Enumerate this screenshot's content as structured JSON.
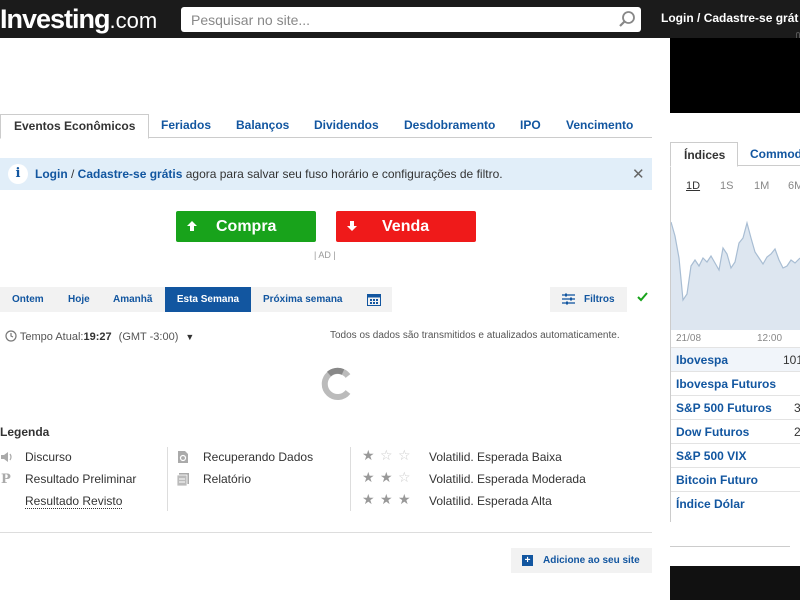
{
  "header": {
    "logo_main": "Investing",
    "logo_suffix": ".com",
    "search_placeholder": "Pesquisar no site...",
    "login": "Login",
    "separator": "/",
    "signup": "Cadastre-se grát"
  },
  "tabs": [
    {
      "label": "Eventos Econômicos",
      "active": true
    },
    {
      "label": "Feriados"
    },
    {
      "label": "Balanços"
    },
    {
      "label": "Dividendos"
    },
    {
      "label": "Desdobramento"
    },
    {
      "label": "IPO"
    },
    {
      "label": "Vencimento"
    }
  ],
  "banner": {
    "icon": "info-icon",
    "login": "Login",
    "separator": " / ",
    "signup": "Cadastre-se grátis",
    "text": " agora para salvar seu fuso horário e configurações de filtro."
  },
  "trade": {
    "buy_label": "Compra",
    "sell_label": "Venda",
    "ad_tag": "| AD |",
    "buy_color": "#18a31b",
    "sell_color": "#ef1a1a"
  },
  "date_tabs": [
    {
      "label": "Ontem"
    },
    {
      "label": "Hoje"
    },
    {
      "label": "Amanhã"
    },
    {
      "label": "Esta Semana",
      "active": true
    },
    {
      "label": "Próxima semana"
    }
  ],
  "filters_label": "Filtros",
  "time": {
    "label": "Tempo Atual:",
    "value": "19:27",
    "tz": "(GMT -3:00)"
  },
  "stream_note": "Todos os dados são transmitidos e atualizados automaticamente.",
  "legend": {
    "title": "Legenda",
    "col1": [
      "Discurso",
      "Resultado Preliminar",
      "Resultado Revisto"
    ],
    "col2": [
      "Recuperando Dados",
      "Relatório"
    ],
    "volatility": [
      {
        "label": "Volatilid. Esperada Baixa",
        "stars": 1
      },
      {
        "label": "Volatilid. Esperada Moderada",
        "stars": 2
      },
      {
        "label": "Volatilid. Esperada Alta",
        "stars": 3
      }
    ]
  },
  "add_site": "Adicione ao seu site",
  "widget": {
    "tabs": [
      "Índices",
      "Commod"
    ],
    "ranges": [
      "1D",
      "1S",
      "1M",
      "6M"
    ],
    "x_labels": [
      "21/08",
      "12:00"
    ],
    "rows": [
      {
        "name": "Ibovespa",
        "value": "101"
      },
      {
        "name": "Ibovespa Futuros",
        "value": ""
      },
      {
        "name": "S&P 500 Futuros",
        "value": "3"
      },
      {
        "name": "Dow Futuros",
        "value": "2"
      },
      {
        "name": "S&P 500 VIX",
        "value": ""
      },
      {
        "name": "Bitcoin Futuro",
        "value": ""
      },
      {
        "name": "Índice Dólar",
        "value": ""
      }
    ]
  },
  "colors": {
    "brand_blue": "#1256a0",
    "header_bg": "#1b1b1b",
    "banner_bg": "#e1eef9"
  }
}
